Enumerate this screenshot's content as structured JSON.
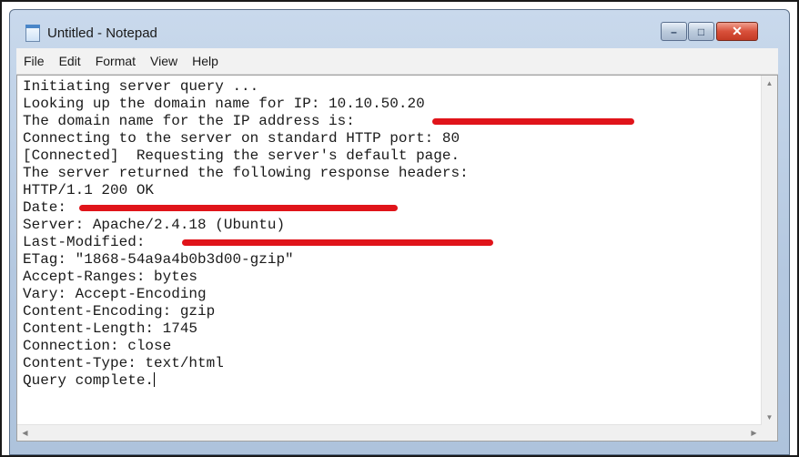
{
  "window": {
    "title": "Untitled - Notepad",
    "controls": {
      "minimize": "–",
      "maximize": "□",
      "close": "✕"
    }
  },
  "menu": {
    "items": [
      "File",
      "Edit",
      "Format",
      "View",
      "Help"
    ]
  },
  "document": {
    "lines": [
      "Initiating server query ...",
      "Looking up the domain name for IP: 10.10.50.20",
      "The domain name for the IP address is:",
      "Connecting to the server on standard HTTP port: 80",
      "[Connected]  Requesting the server's default page.",
      "The server returned the following response headers:",
      "HTTP/1.1 200 OK",
      "Date:",
      "Server: Apache/2.4.18 (Ubuntu)",
      "Last-Modified:",
      "ETag: \"1868-54a9a4b0b3d00-gzip\"",
      "Accept-Ranges: bytes",
      "Vary: Accept-Encoding",
      "Content-Encoding: gzip",
      "Content-Length: 1745",
      "Connection: close",
      "Content-Type: text/html",
      "Query complete."
    ],
    "redaction_color": "#e0141a"
  },
  "scrollbars": {
    "up_arrow": "▲",
    "down_arrow": "▼",
    "left_arrow": "◀",
    "right_arrow": "▶"
  }
}
